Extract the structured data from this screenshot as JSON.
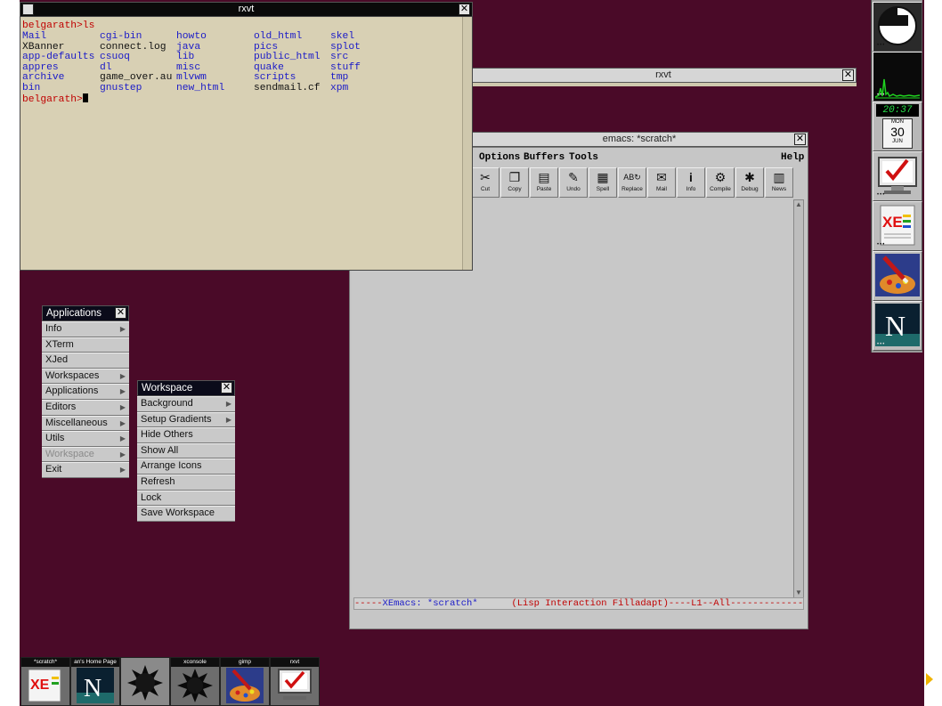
{
  "rxvt_main": {
    "title": "rxvt",
    "prompt_cmd": "belgarath>ls",
    "prompt": "belgarath>",
    "columns": [
      [
        "Mail",
        "XBanner",
        "app-defaults",
        "appres",
        "archive",
        "bin"
      ],
      [
        "cgi-bin",
        "connect.log",
        "csuoq",
        "dl",
        "game_over.au",
        "gnustep"
      ],
      [
        "howto",
        "java",
        "lib",
        "misc",
        "mlvwm",
        "new_html"
      ],
      [
        "old_html",
        "pics",
        "public_html",
        "quake",
        "scripts",
        "sendmail.cf"
      ],
      [
        "skel",
        "splot",
        "src",
        "stuff",
        "tmp",
        "xpm"
      ]
    ]
  },
  "rxvt_background": {
    "title": "rxvt"
  },
  "emacs": {
    "title": "emacs: *scratch*",
    "menu": {
      "options": "Options",
      "buffers": "Buffers",
      "tools": "Tools",
      "help": "Help"
    },
    "toolbar": [
      "Cut",
      "Copy",
      "Paste",
      "Undo",
      "Spell",
      "Replace",
      "Mail",
      "Info",
      "Compile",
      "Debug",
      "News"
    ],
    "modeline_prefix": "-----",
    "modeline_buffer": "XEmacs: *scratch*",
    "modeline_mode": "(Lisp Interaction Filladapt)",
    "modeline_suffix": "----L1--All-------------"
  },
  "applications_menu": {
    "title": "Applications",
    "items": [
      "Info",
      "XTerm",
      "XJed",
      "Workspaces",
      "Applications",
      "Editors",
      "Miscellaneous",
      "Utils",
      "Workspace",
      "Exit"
    ]
  },
  "workspace_menu": {
    "title": "Workspace",
    "items": [
      "Background",
      "Setup Gradients",
      "Hide Others",
      "Show All",
      "Arrange Icons",
      "Refresh",
      "Lock",
      "Save Workspace"
    ]
  },
  "dock": {
    "clock_time": "20:37",
    "clock_day_name": "MON",
    "clock_day": "30",
    "clock_month": "JUN",
    "icons": [
      "gnustep-logo-icon",
      "cpu-load-monitor-icon",
      "clock-icon",
      "task-check-icon",
      "xemacs-icon",
      "gimp-icon",
      "netscape-icon"
    ]
  },
  "taskbar": {
    "labels": [
      "*scratch*",
      "an's Home Page",
      "",
      "xconsole",
      "gimp",
      "rxvt"
    ]
  },
  "colors": {
    "desktop": "#4a0a28",
    "terminal_bg": "#d8d0b4",
    "prompt_red": "#c00000",
    "dir_blue": "#1a1ac8"
  }
}
